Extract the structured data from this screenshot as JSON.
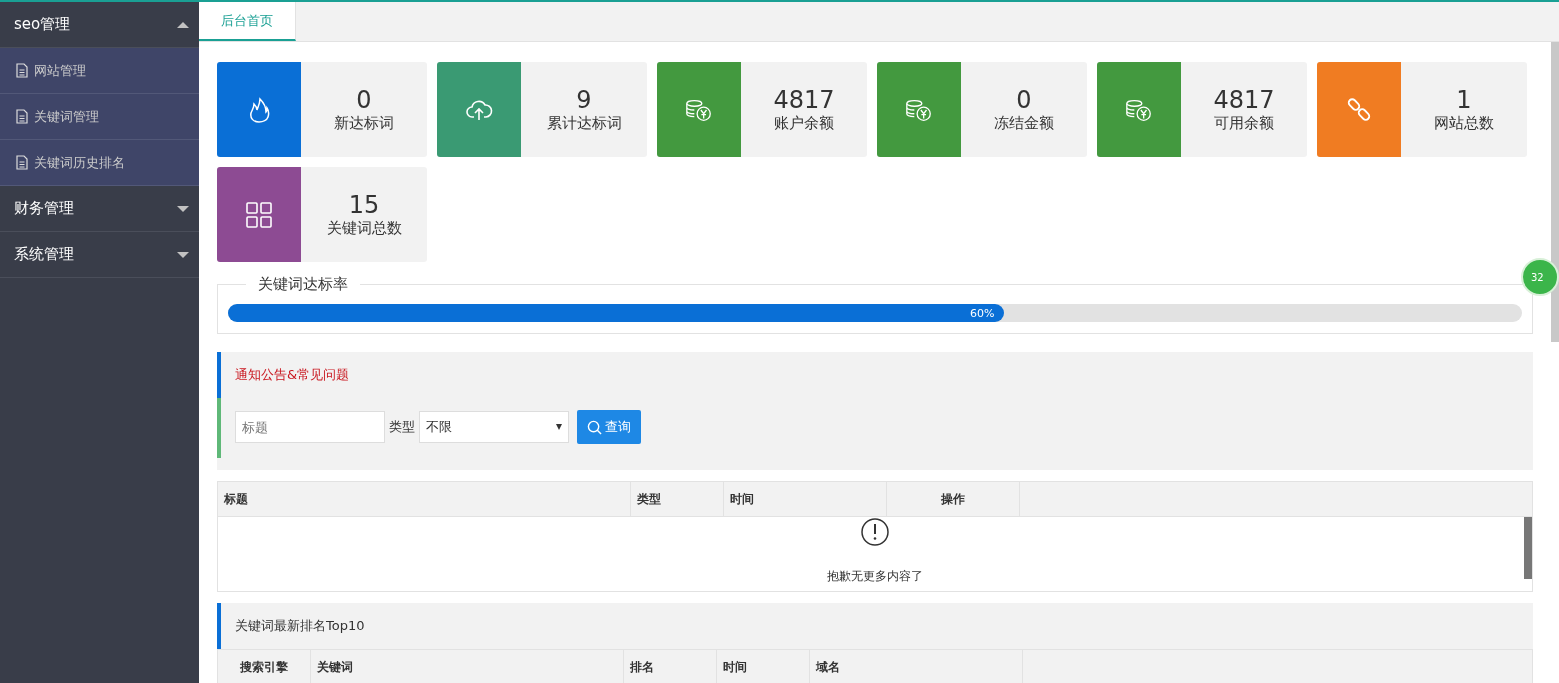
{
  "sidebar": {
    "groups": [
      {
        "label": "seo管理",
        "expanded": true,
        "items": [
          {
            "label": "网站管理"
          },
          {
            "label": "关键词管理"
          },
          {
            "label": "关键词历史排名"
          }
        ]
      },
      {
        "label": "财务管理",
        "expanded": false
      },
      {
        "label": "系统管理",
        "expanded": false
      }
    ]
  },
  "tabs": [
    {
      "label": "后台首页",
      "selected": true
    }
  ],
  "stats": [
    {
      "kind": "fire",
      "color": "#0a6fd6",
      "value": "0",
      "label": "新达标词"
    },
    {
      "kind": "upload",
      "color": "#3a9a73",
      "value": "9",
      "label": "累计达标词"
    },
    {
      "kind": "coins",
      "color": "#43993f",
      "value": "4817",
      "label": "账户余额"
    },
    {
      "kind": "coins",
      "color": "#43993f",
      "value": "0",
      "label": "冻结金额"
    },
    {
      "kind": "coins",
      "color": "#43993f",
      "value": "4817",
      "label": "可用余额"
    },
    {
      "kind": "link",
      "color": "#f07c22",
      "value": "1",
      "label": "网站总数"
    },
    {
      "kind": "grid",
      "color": "#8d4b93",
      "value": "15",
      "label": "关键词总数"
    }
  ],
  "progress": {
    "title": "关键词达标率",
    "level": 0.6,
    "reading": "60%"
  },
  "notice": {
    "title": "通知公告&常见问题",
    "search": {
      "placeholder": "标题"
    },
    "type_label": "类型",
    "type_value": "不限",
    "button": "查询",
    "columns": [
      "标题",
      "类型",
      "时间",
      "操作"
    ],
    "empty_text": "抱歉无更多内容了"
  },
  "ranking": {
    "title": "关键词最新排名Top10",
    "columns": [
      "搜索引擎",
      "关键词",
      "排名",
      "时间",
      "域名"
    ]
  },
  "float_badge": "32"
}
